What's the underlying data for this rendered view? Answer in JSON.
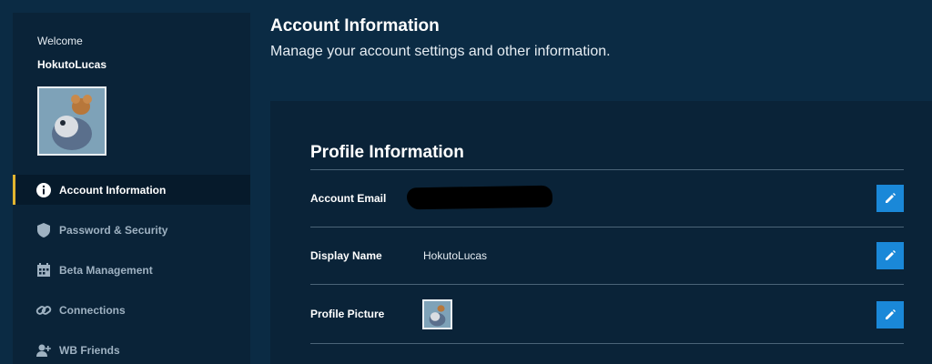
{
  "sidebar": {
    "welcome": "Welcome",
    "username": "HokutoLucas",
    "items": [
      {
        "label": "Account Information",
        "icon": "info-icon",
        "active": true
      },
      {
        "label": "Password & Security",
        "icon": "shield-icon",
        "active": false
      },
      {
        "label": "Beta Management",
        "icon": "calendar-icon",
        "active": false
      },
      {
        "label": "Connections",
        "icon": "link-icon",
        "active": false
      },
      {
        "label": "WB Friends",
        "icon": "add-user-icon",
        "active": false
      }
    ]
  },
  "header": {
    "title": "Account Information",
    "subtitle": "Manage your account settings and other information."
  },
  "profile": {
    "section_title": "Profile Information",
    "rows": [
      {
        "label": "Account Email",
        "value": ""
      },
      {
        "label": "Display Name",
        "value": "HokutoLucas"
      },
      {
        "label": "Profile Picture",
        "value": ""
      }
    ]
  },
  "colors": {
    "background": "#0b2b44",
    "panel": "#0a2338",
    "active_nav": "#061a2b",
    "accent_bar": "#e2b530",
    "edit_button": "#1a88d8"
  }
}
